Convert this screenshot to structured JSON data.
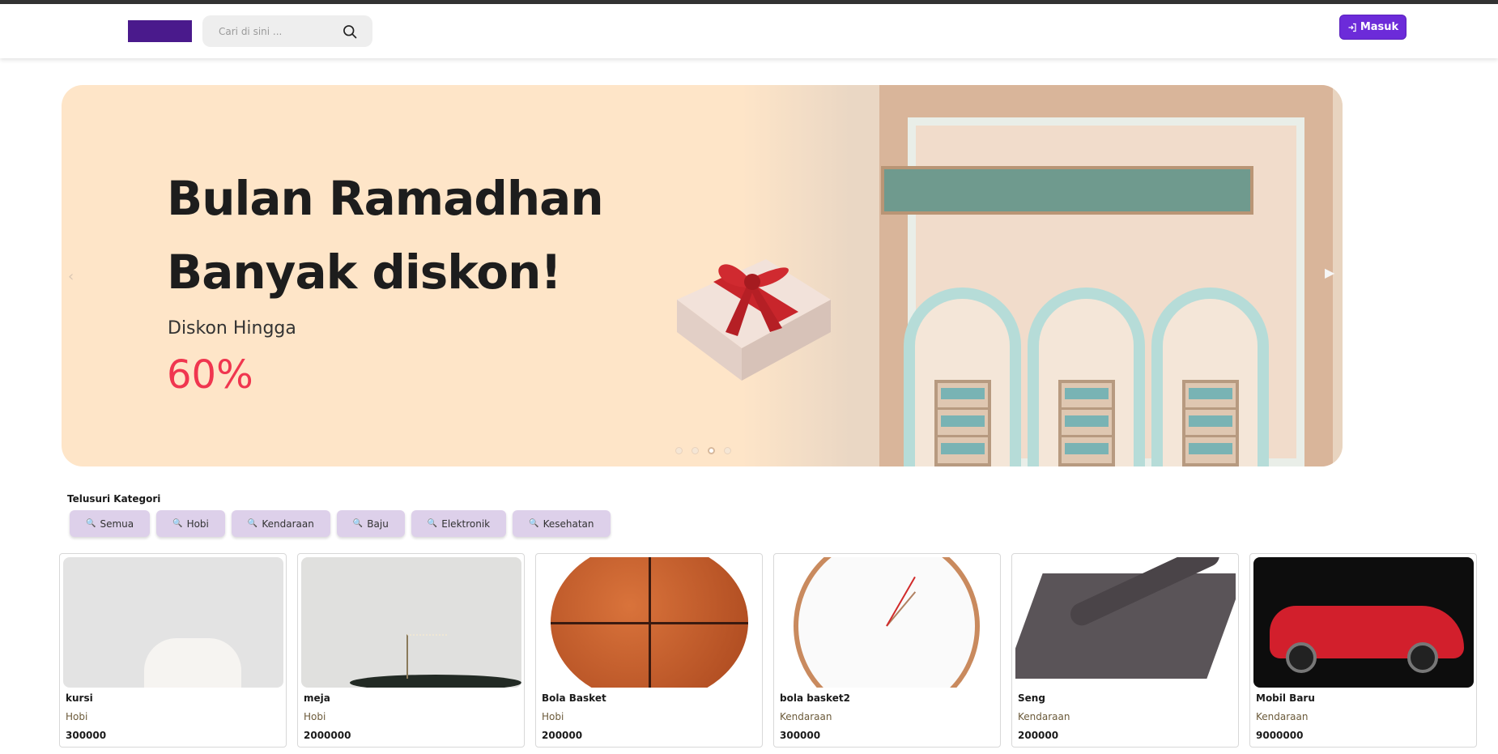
{
  "header": {
    "search_placeholder": "Cari di sini ...",
    "login_label": "Masuk"
  },
  "banner": {
    "line1": "Bulan Ramadhan",
    "line2": "Banyak diskon!",
    "diskon_label": "Diskon Hingga",
    "diskon_value": "60%",
    "active_slide": 3,
    "slide_count": 4
  },
  "categories": {
    "title": "Telusuri Kategori",
    "items": [
      "Semua",
      "Hobi",
      "Kendaraan",
      "Baju",
      "Elektronik",
      "Kesehatan"
    ]
  },
  "products": [
    {
      "name": "kursi",
      "category": "Hobi",
      "price": "300000"
    },
    {
      "name": "meja",
      "category": "Hobi",
      "price": "2000000"
    },
    {
      "name": "Bola Basket",
      "category": "Hobi",
      "price": "200000"
    },
    {
      "name": "bola basket2",
      "category": "Kendaraan",
      "price": "300000"
    },
    {
      "name": "Seng",
      "category": "Kendaraan",
      "price": "200000"
    },
    {
      "name": "Mobil Baru",
      "category": "Kendaraan",
      "price": "9000000"
    }
  ],
  "colors": {
    "brand": "#4a1a8c",
    "accent": "#6c2bd9",
    "discount": "#f0364f",
    "category_chip": "#ddd0ea"
  }
}
